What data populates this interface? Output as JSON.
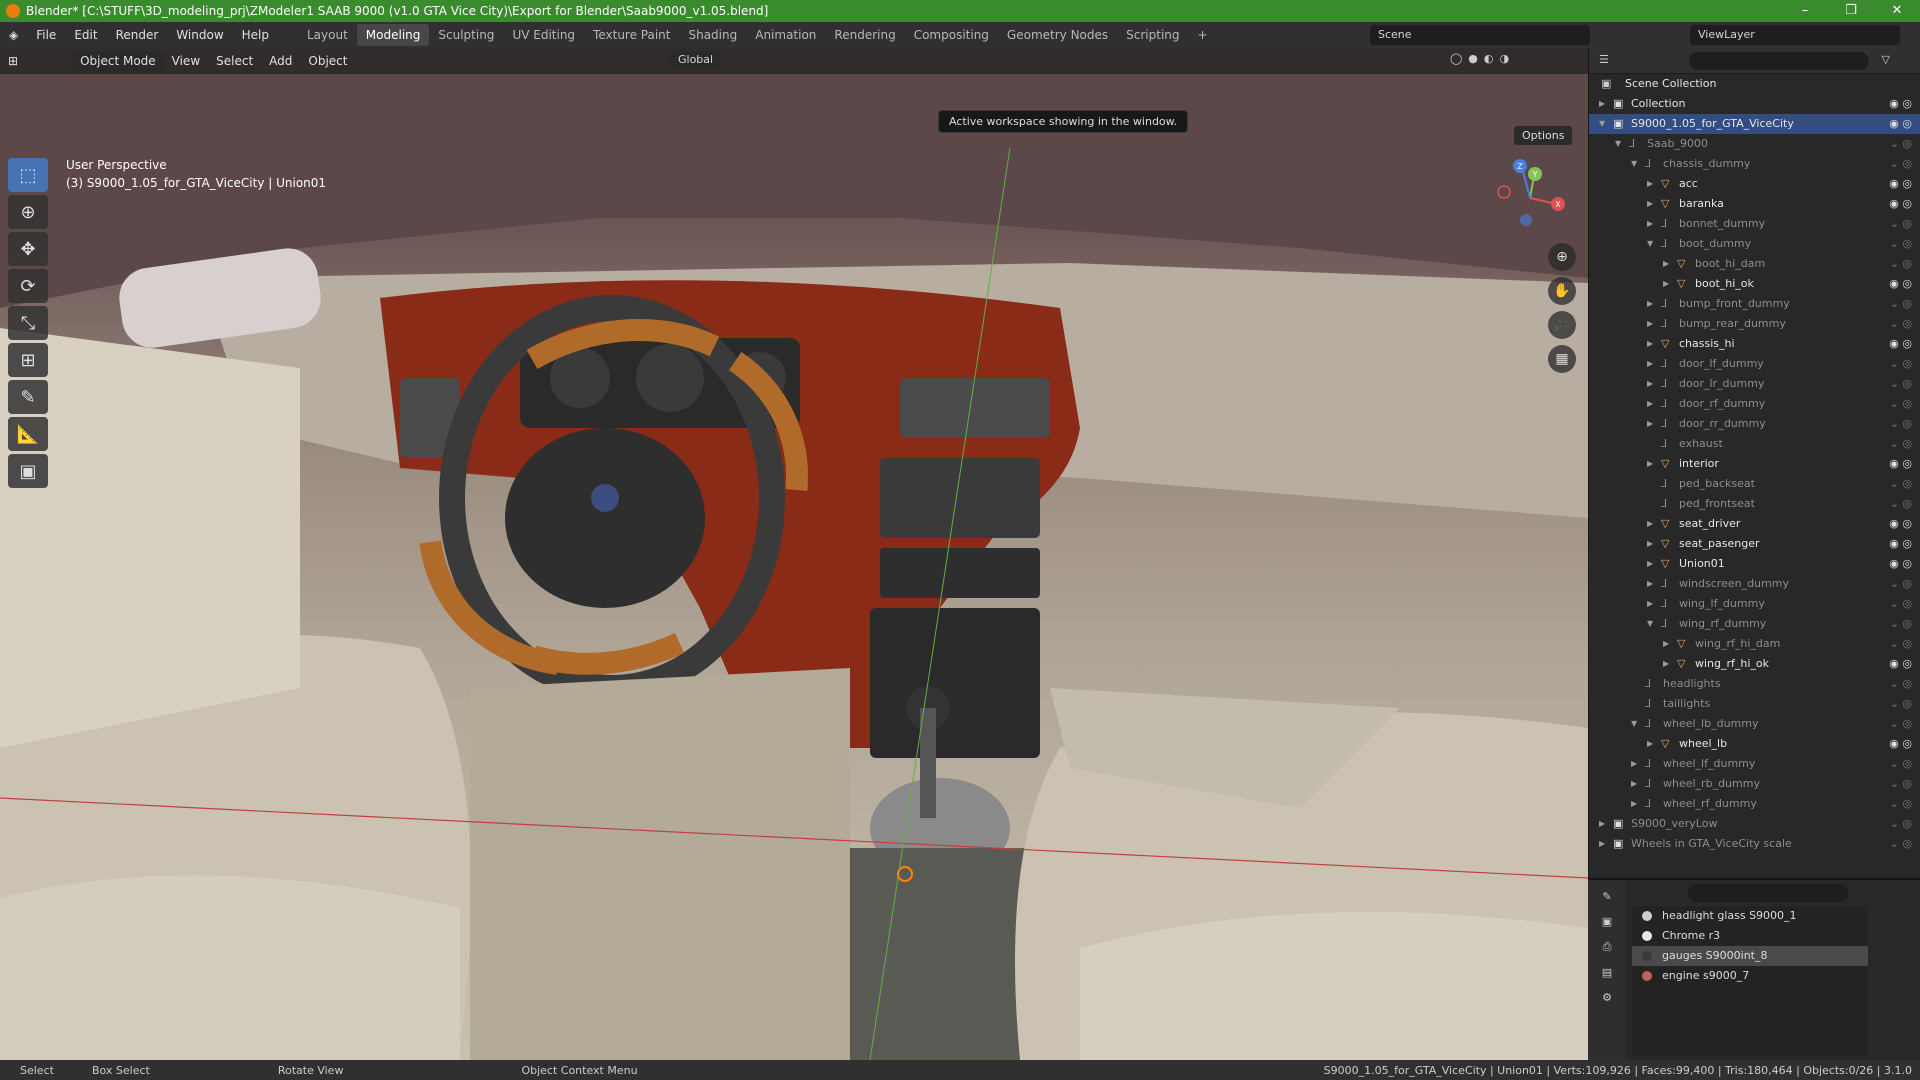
{
  "title": "Blender* [C:\\STUFF\\3D_modeling_prj\\ZModeler1 SAAB 9000 (v1.0 GTA Vice City)\\Export for Blender\\Saab9000_v1.05.blend]",
  "menu": [
    "File",
    "Edit",
    "Render",
    "Window",
    "Help"
  ],
  "workspaces": [
    "Layout",
    "Modeling",
    "Sculpting",
    "UV Editing",
    "Texture Paint",
    "Shading",
    "Animation",
    "Rendering",
    "Compositing",
    "Geometry Nodes",
    "Scripting"
  ],
  "active_workspace": "Modeling",
  "scene_name": "Scene",
  "view_layer": "ViewLayer",
  "viewport_header": {
    "mode": "Object Mode",
    "menus": [
      "View",
      "Select",
      "Add",
      "Object"
    ],
    "transform_orientation": "Global",
    "options_label": "Options"
  },
  "tooltip": "Active workspace showing in the window.",
  "viewport_info": {
    "line1": "User Perspective",
    "line2": "(3) S9000_1.05_for_GTA_ViceCity | Union01"
  },
  "gizmo_axes": [
    "X",
    "Y",
    "Z"
  ],
  "outliner": {
    "root": "Scene Collection",
    "rows": [
      {
        "label": "Collection",
        "depth": 0,
        "type": "collection",
        "arrow": "right",
        "dim": false,
        "sel": false
      },
      {
        "label": "S9000_1.05_for_GTA_ViceCity",
        "depth": 0,
        "type": "collection",
        "arrow": "down",
        "dim": false,
        "sel": true
      },
      {
        "label": "Saab_9000",
        "depth": 1,
        "type": "empty",
        "arrow": "down",
        "dim": true,
        "sel": false
      },
      {
        "label": "chassis_dummy",
        "depth": 2,
        "type": "empty",
        "arrow": "down",
        "dim": true,
        "sel": false
      },
      {
        "label": "acc",
        "depth": 3,
        "type": "mesh",
        "arrow": "right",
        "dim": false,
        "sel": false
      },
      {
        "label": "baranka",
        "depth": 3,
        "type": "mesh",
        "arrow": "right",
        "dim": false,
        "sel": false
      },
      {
        "label": "bonnet_dummy",
        "depth": 3,
        "type": "empty",
        "arrow": "right",
        "dim": true,
        "sel": false
      },
      {
        "label": "boot_dummy",
        "depth": 3,
        "type": "empty",
        "arrow": "down",
        "dim": true,
        "sel": false
      },
      {
        "label": "boot_hi_dam",
        "depth": 4,
        "type": "mesh",
        "arrow": "right",
        "dim": true,
        "sel": false
      },
      {
        "label": "boot_hi_ok",
        "depth": 4,
        "type": "mesh",
        "arrow": "right",
        "dim": false,
        "sel": false
      },
      {
        "label": "bump_front_dummy",
        "depth": 3,
        "type": "empty",
        "arrow": "right",
        "dim": true,
        "sel": false
      },
      {
        "label": "bump_rear_dummy",
        "depth": 3,
        "type": "empty",
        "arrow": "right",
        "dim": true,
        "sel": false
      },
      {
        "label": "chassis_hi",
        "depth": 3,
        "type": "mesh",
        "arrow": "right",
        "dim": false,
        "sel": false
      },
      {
        "label": "door_lf_dummy",
        "depth": 3,
        "type": "empty",
        "arrow": "right",
        "dim": true,
        "sel": false
      },
      {
        "label": "door_lr_dummy",
        "depth": 3,
        "type": "empty",
        "arrow": "right",
        "dim": true,
        "sel": false
      },
      {
        "label": "door_rf_dummy",
        "depth": 3,
        "type": "empty",
        "arrow": "right",
        "dim": true,
        "sel": false
      },
      {
        "label": "door_rr_dummy",
        "depth": 3,
        "type": "empty",
        "arrow": "right",
        "dim": true,
        "sel": false
      },
      {
        "label": "exhaust",
        "depth": 3,
        "type": "empty",
        "arrow": "",
        "dim": true,
        "sel": false
      },
      {
        "label": "interior",
        "depth": 3,
        "type": "mesh",
        "arrow": "right",
        "dim": false,
        "sel": false
      },
      {
        "label": "ped_backseat",
        "depth": 3,
        "type": "empty",
        "arrow": "",
        "dim": true,
        "sel": false
      },
      {
        "label": "ped_frontseat",
        "depth": 3,
        "type": "empty",
        "arrow": "",
        "dim": true,
        "sel": false
      },
      {
        "label": "seat_driver",
        "depth": 3,
        "type": "mesh",
        "arrow": "right",
        "dim": false,
        "sel": false
      },
      {
        "label": "seat_pasenger",
        "depth": 3,
        "type": "mesh",
        "arrow": "right",
        "dim": false,
        "sel": false
      },
      {
        "label": "Union01",
        "depth": 3,
        "type": "mesh",
        "arrow": "right",
        "dim": false,
        "sel": false
      },
      {
        "label": "windscreen_dummy",
        "depth": 3,
        "type": "empty",
        "arrow": "right",
        "dim": true,
        "sel": false
      },
      {
        "label": "wing_lf_dummy",
        "depth": 3,
        "type": "empty",
        "arrow": "right",
        "dim": true,
        "sel": false
      },
      {
        "label": "wing_rf_dummy",
        "depth": 3,
        "type": "empty",
        "arrow": "down",
        "dim": true,
        "sel": false
      },
      {
        "label": "wing_rf_hi_dam",
        "depth": 4,
        "type": "mesh",
        "arrow": "right",
        "dim": true,
        "sel": false
      },
      {
        "label": "wing_rf_hi_ok",
        "depth": 4,
        "type": "mesh",
        "arrow": "right",
        "dim": false,
        "sel": false
      },
      {
        "label": "headlights",
        "depth": 2,
        "type": "empty",
        "arrow": "",
        "dim": true,
        "sel": false
      },
      {
        "label": "taillights",
        "depth": 2,
        "type": "empty",
        "arrow": "",
        "dim": true,
        "sel": false
      },
      {
        "label": "wheel_lb_dummy",
        "depth": 2,
        "type": "empty",
        "arrow": "down",
        "dim": true,
        "sel": false
      },
      {
        "label": "wheel_lb",
        "depth": 3,
        "type": "mesh",
        "arrow": "right",
        "dim": false,
        "sel": false
      },
      {
        "label": "wheel_lf_dummy",
        "depth": 2,
        "type": "empty",
        "arrow": "right",
        "dim": true,
        "sel": false
      },
      {
        "label": "wheel_rb_dummy",
        "depth": 2,
        "type": "empty",
        "arrow": "right",
        "dim": true,
        "sel": false
      },
      {
        "label": "wheel_rf_dummy",
        "depth": 2,
        "type": "empty",
        "arrow": "right",
        "dim": true,
        "sel": false
      },
      {
        "label": "S9000_veryLow",
        "depth": 0,
        "type": "collection",
        "arrow": "right",
        "dim": true,
        "sel": false
      },
      {
        "label": "Wheels in GTA_ViceCity scale",
        "depth": 0,
        "type": "collection",
        "arrow": "right",
        "dim": true,
        "sel": false
      }
    ]
  },
  "materials": [
    {
      "name": "headlight glass S9000_1",
      "color": "#cfcfcf",
      "sel": false
    },
    {
      "name": "Chrome r3",
      "color": "#e8e8e8",
      "sel": false
    },
    {
      "name": "gauges S9000int_8",
      "color": "#3a3a3a",
      "sel": true
    },
    {
      "name": "engine s9000_7",
      "color": "#c06060",
      "sel": false
    }
  ],
  "status": {
    "select": "Select",
    "box_select": "Box Select",
    "rotate_view": "Rotate View",
    "context_menu": "Object Context Menu",
    "stats": "S9000_1.05_for_GTA_ViceCity | Union01 | Verts:109,926 | Faces:99,400 | Tris:180,464 | Objects:0/26 | 3.1.0"
  },
  "colors": {
    "title_bar": "#3a8a2e",
    "selection": "#334d80",
    "active_tool": "#4772b3",
    "mesh_icon": "#e8a35a",
    "empty_icon": "#8c8c8c"
  }
}
